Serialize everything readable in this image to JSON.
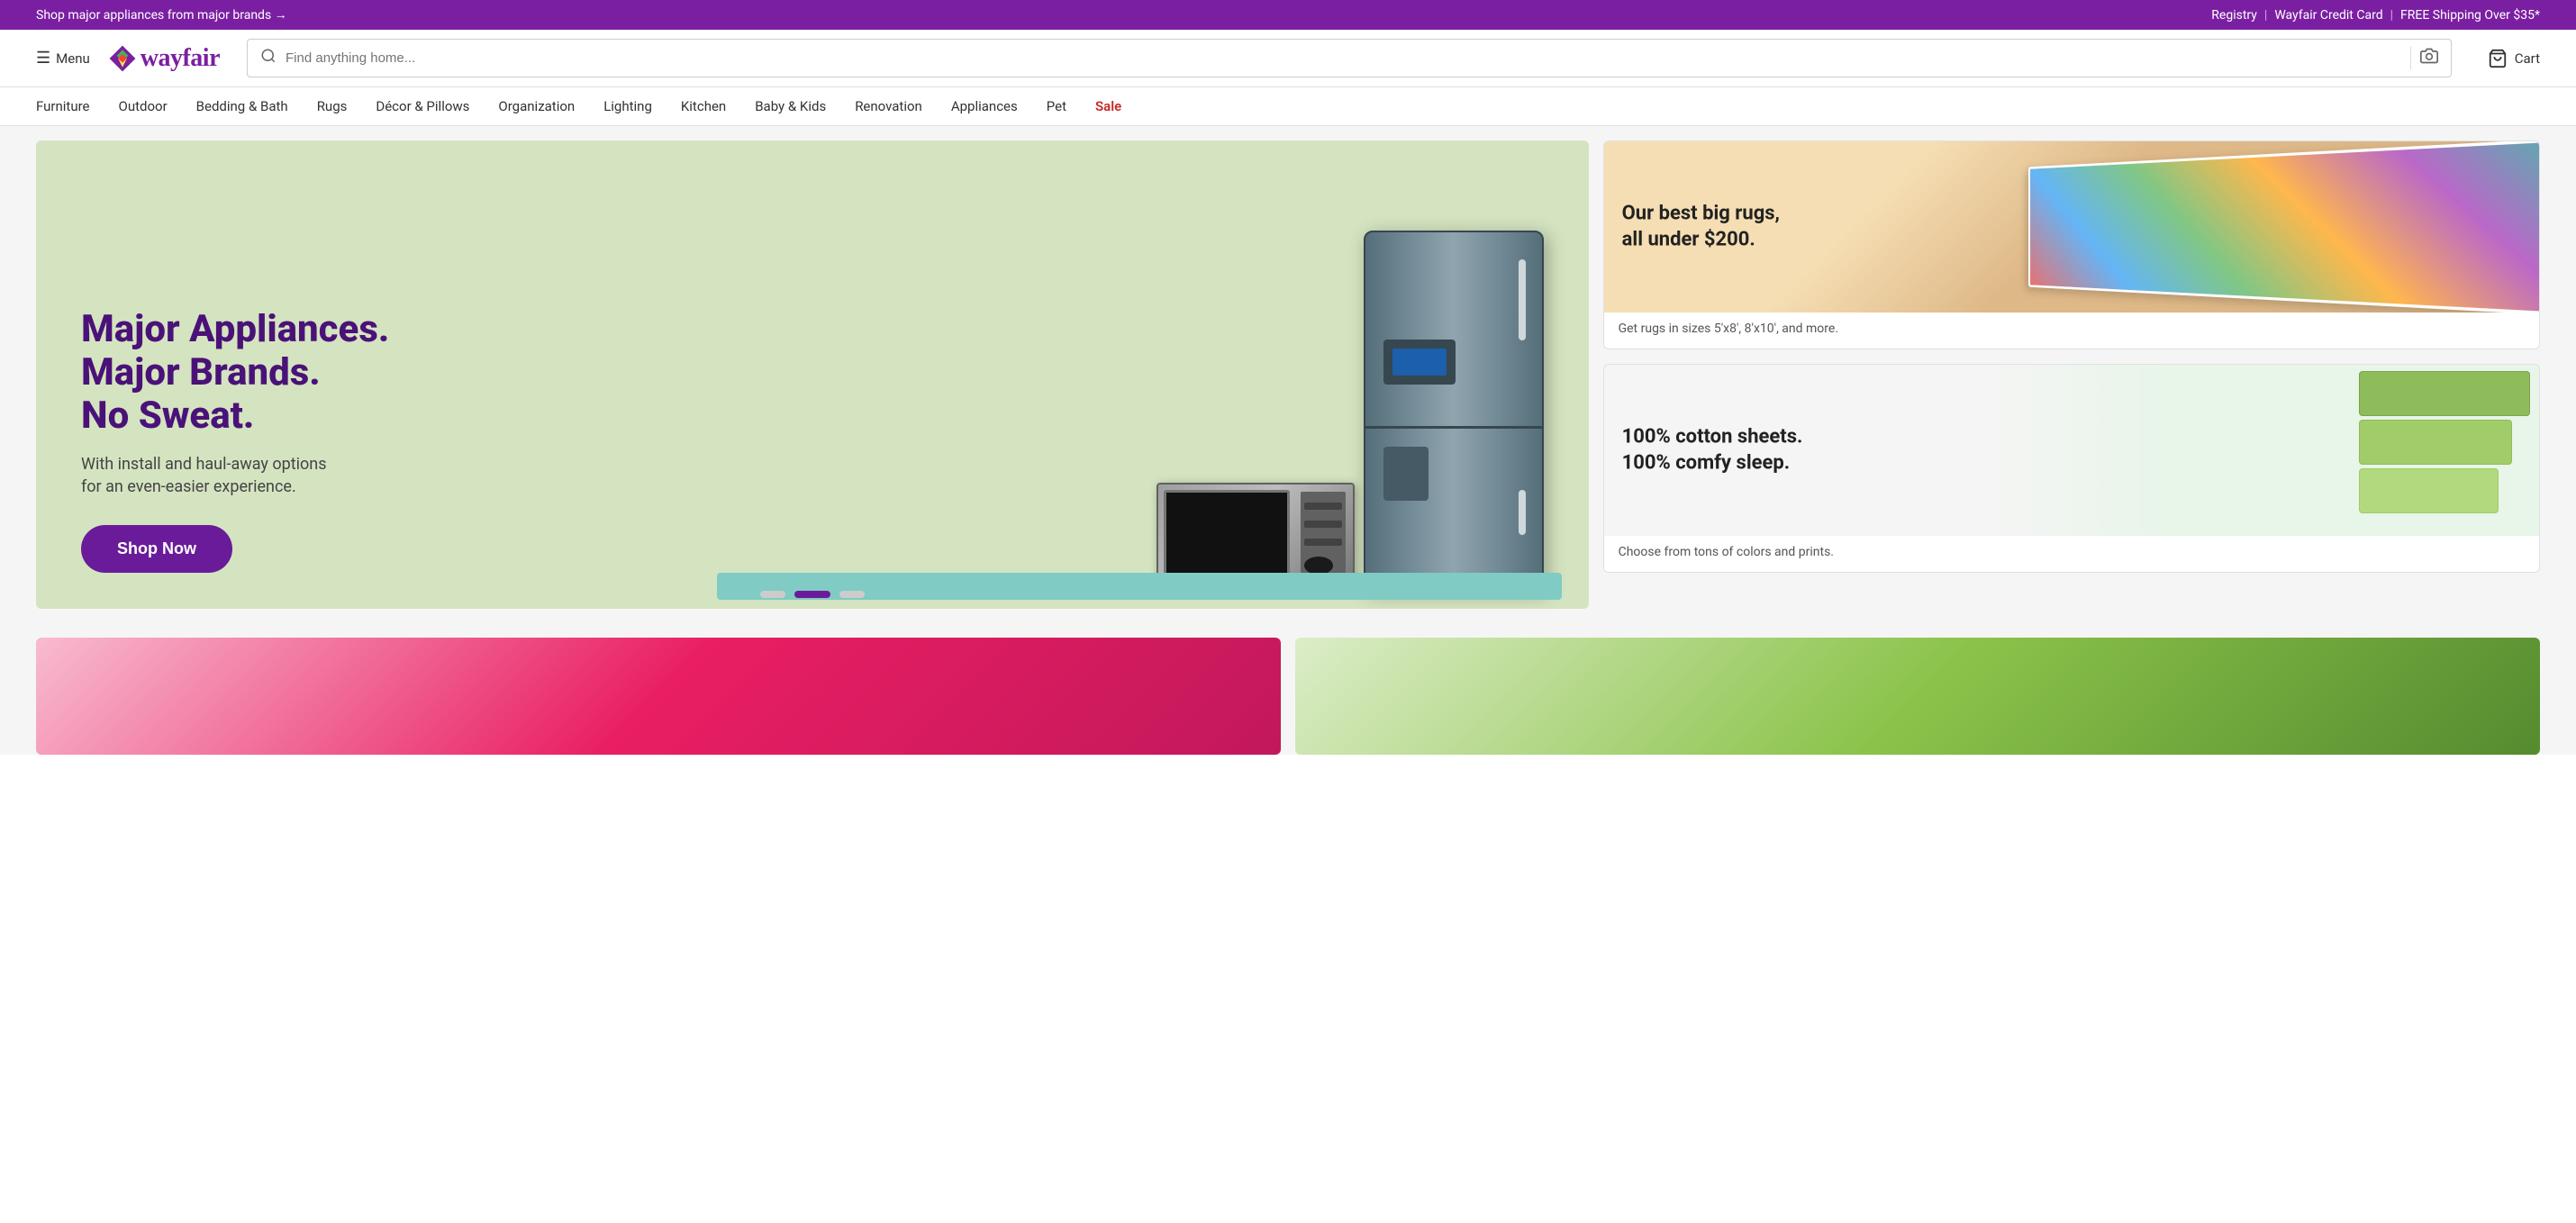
{
  "top_banner": {
    "left_text": "Shop major appliances from major brands →",
    "right_items": [
      "Registry",
      "|",
      "Wayfair Credit Card",
      "|",
      "FREE Shipping Over $35*"
    ]
  },
  "header": {
    "menu_label": "Menu",
    "logo_text": "wayfair",
    "search_placeholder": "Find anything home...",
    "cart_label": "Cart"
  },
  "nav": {
    "items": [
      {
        "label": "Furniture",
        "href": "#"
      },
      {
        "label": "Outdoor",
        "href": "#"
      },
      {
        "label": "Bedding & Bath",
        "href": "#"
      },
      {
        "label": "Rugs",
        "href": "#"
      },
      {
        "label": "Décor & Pillows",
        "href": "#"
      },
      {
        "label": "Organization",
        "href": "#"
      },
      {
        "label": "Lighting",
        "href": "#"
      },
      {
        "label": "Kitchen",
        "href": "#"
      },
      {
        "label": "Baby & Kids",
        "href": "#"
      },
      {
        "label": "Renovation",
        "href": "#"
      },
      {
        "label": "Appliances",
        "href": "#"
      },
      {
        "label": "Pet",
        "href": "#"
      },
      {
        "label": "Sale",
        "href": "#",
        "class": "sale"
      }
    ]
  },
  "hero_main": {
    "headline_line1": "Major Appliances.",
    "headline_line2": "Major Brands.",
    "headline_line3": "No Sweat.",
    "subtext": "With install and haul-away options\nfor an even-easier experience.",
    "cta_label": "Shop Now"
  },
  "carousel_dots": [
    {
      "active": false
    },
    {
      "active": true
    },
    {
      "active": false
    }
  ],
  "side_banner_1": {
    "headline": "Our best big rugs,\nall under $200.",
    "subtext": "Get rugs in sizes 5'x8', 8'x10', and more."
  },
  "side_banner_2": {
    "headline": "100% cotton sheets.\n100% comfy sleep.",
    "subtext": "Choose from tons of colors and prints."
  }
}
